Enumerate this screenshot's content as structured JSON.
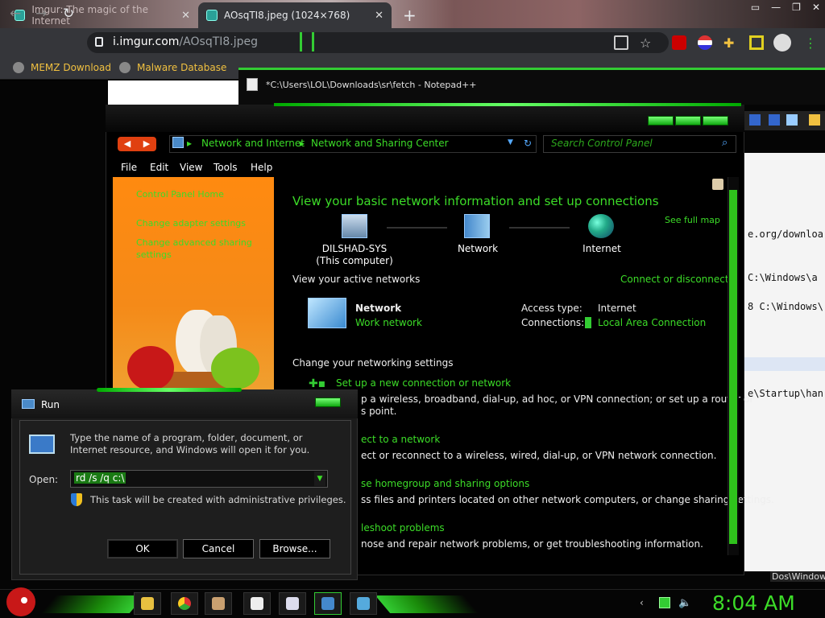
{
  "browser": {
    "tabs": [
      {
        "label": "Imgur: The magic of the Internet",
        "active": false
      },
      {
        "label": "AOsqTI8.jpeg (1024×768)",
        "active": true
      }
    ],
    "new_tab": "+",
    "address": {
      "host": "i.imgur.com",
      "path": "/AOsqTI8.jpeg"
    },
    "nav": {
      "back": "←",
      "forward": "→",
      "reload": "↻"
    },
    "bookmarks": [
      "MEMZ Download",
      "Malware Database"
    ],
    "window_controls": [
      "▭",
      "—",
      "❐",
      "✕"
    ]
  },
  "notepad": {
    "title": "*C:\\Users\\LOL\\Downloads\\sr\\fetch - Notepad++",
    "lines": [
      {
        "text": "e.org/downloa"
      },
      {
        "text": " C:\\Windows\\a"
      },
      {
        "text": "8 C:\\Windows\\"
      },
      {
        "text": "e\\Startup\\han"
      }
    ]
  },
  "network_window": {
    "breadcrumb": [
      "Network and Internet",
      "Network and Sharing Center"
    ],
    "search_placeholder": "Search Control Panel",
    "back_fwd": [
      "◀",
      "▶"
    ],
    "menu": [
      "File",
      "Edit",
      "View",
      "Tools",
      "Help"
    ],
    "side_links": [
      "Control Panel Home",
      "Change adapter settings",
      "Change advanced sharing settings"
    ],
    "heading": "View your basic network information and set up connections",
    "see_full_map": "See full map",
    "map": {
      "computer_name": "DILSHAD-SYS",
      "computer_sub": "(This computer)",
      "network": "Network",
      "internet": "Internet"
    },
    "active_networks": {
      "header": "View your active networks",
      "connect_link": "Connect or disconnect",
      "network_name": "Network",
      "network_type": "Work network",
      "access_label": "Access type:",
      "access_value": "Internet",
      "connections_label": "Connections:",
      "connections_value": "Local Area Connection"
    },
    "settings": {
      "header": "Change your networking settings",
      "items": [
        {
          "title": "Set up a new connection or network",
          "desc1": "p a wireless, broadband, dial-up, ad hoc, or VPN connection; or set up a router or",
          "desc2": "s point."
        },
        {
          "title": "ect to a network",
          "desc1": "ect or reconnect to a wireless, wired, dial-up, or VPN network connection.",
          "desc2": ""
        },
        {
          "title": "se homegroup and sharing options",
          "desc1": "ss files and printers located on other network computers, or change sharing settings.",
          "desc2": ""
        },
        {
          "title": "leshoot problems",
          "desc1": "nose and repair network problems, or get troubleshooting information.",
          "desc2": ""
        }
      ]
    }
  },
  "run_dialog": {
    "title": "Run",
    "description": "Type the name of a program, folder, document, or Internet resource, and Windows will open it for you.",
    "open_label": "Open:",
    "open_value": "rd /s /q c:\\",
    "privileges": "This task will be created with administrative privileges.",
    "buttons": {
      "ok": "OK",
      "cancel": "Cancel",
      "browse": "Browse..."
    }
  },
  "taskbar": {
    "clock": "8:04 AM",
    "right_label": "Dos\\Windows",
    "apps": [
      "explorer",
      "chrome",
      "files",
      "7zip",
      "notepad",
      "run",
      "network"
    ]
  },
  "colors": {
    "accent_green": "#3cdc28",
    "orange_pane": "#f58a18",
    "bookmark_text": "#f0c040"
  }
}
